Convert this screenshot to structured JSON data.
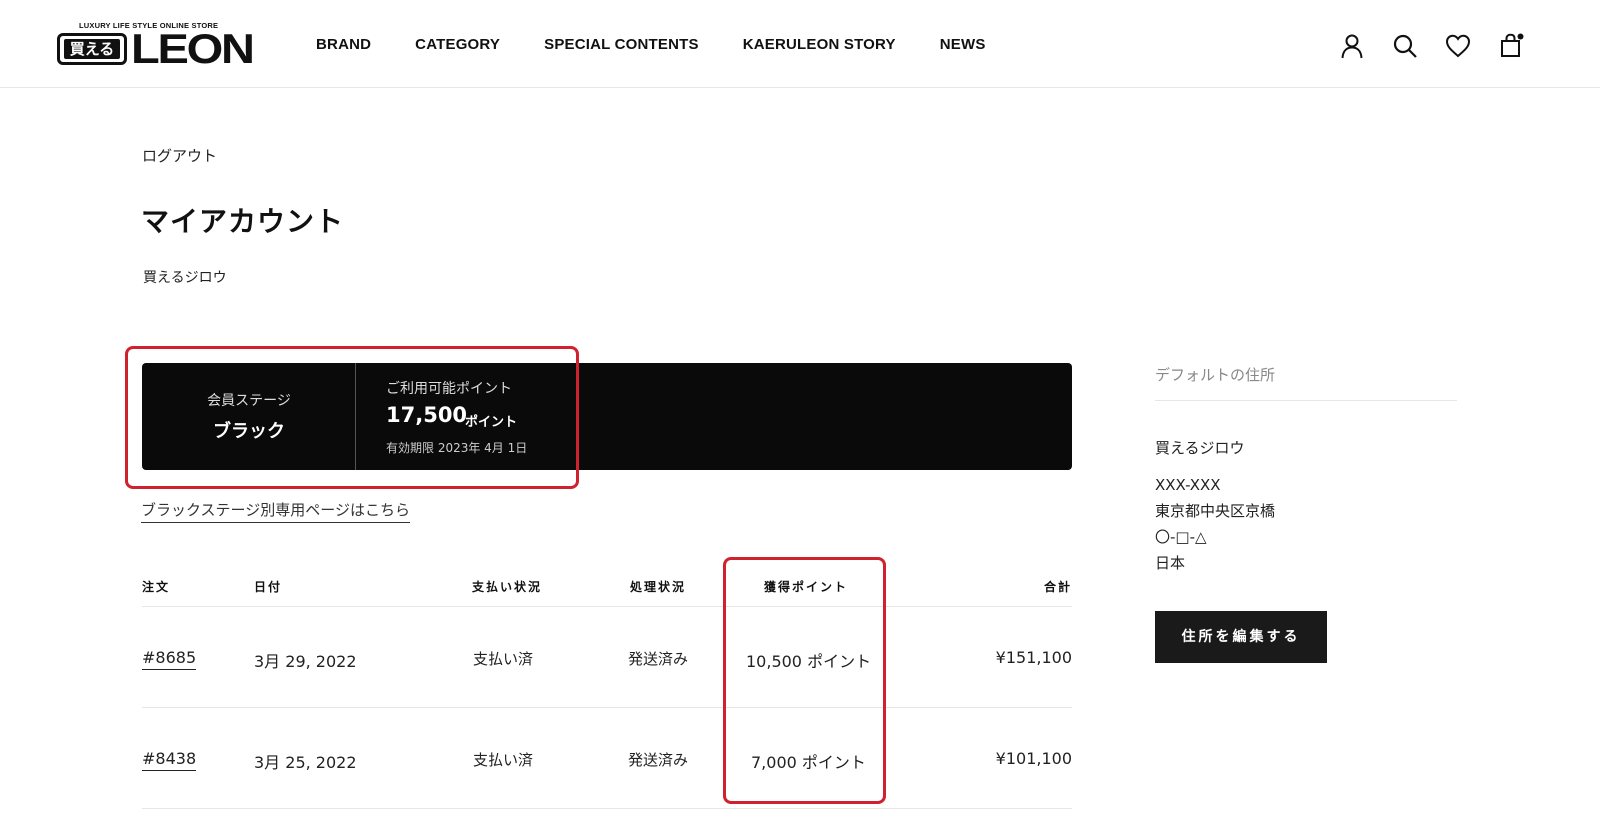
{
  "header": {
    "logo_tagline": "LUXURY LIFE STYLE ONLINE STORE",
    "logo_box_text": "買える",
    "logo_word": "LEON",
    "nav": [
      "BRAND",
      "CATEGORY",
      "SPECIAL CONTENTS",
      "KAERULEON STORY",
      "NEWS"
    ],
    "icons": [
      "account-icon",
      "search-icon",
      "heart-icon",
      "cart-icon"
    ]
  },
  "account": {
    "logout_label": "ログアウト",
    "title": "マイアカウント",
    "customer_name": "買えるジロウ"
  },
  "member": {
    "stage_label": "会員ステージ",
    "stage_value": "ブラック",
    "points_label": "ご利用可能ポイント",
    "points_value": "17,500",
    "points_unit": "ポイント",
    "expiry": "有効期限 2023年 4月 1日",
    "stage_page_link": "ブラックステージ別専用ページはこちら"
  },
  "orders": {
    "headers": {
      "order": "注文",
      "date": "日付",
      "payment": "支払い状況",
      "fulfillment": "処理状況",
      "points": "獲得ポイント",
      "total": "合計"
    },
    "rows": [
      {
        "order": "#8685",
        "date": "3月 29, 2022",
        "payment": "支払い済",
        "fulfillment": "発送済み",
        "points": "10,500 ポイント",
        "total": "¥151,100"
      },
      {
        "order": "#8438",
        "date": "3月 25, 2022",
        "payment": "支払い済",
        "fulfillment": "発送済み",
        "points": "7,000 ポイント",
        "total": "¥101,100"
      }
    ]
  },
  "sidebar": {
    "title": "デフォルトの住所",
    "name": "買えるジロウ",
    "address": [
      "XXX-XXX",
      "東京都中央区京橋",
      "〇-□-△",
      "日本"
    ],
    "edit_button": "住所を編集する"
  },
  "colors": {
    "highlight": "#d0222e",
    "card_bg": "#0a0a0a",
    "button_bg": "#1a1a1a"
  }
}
